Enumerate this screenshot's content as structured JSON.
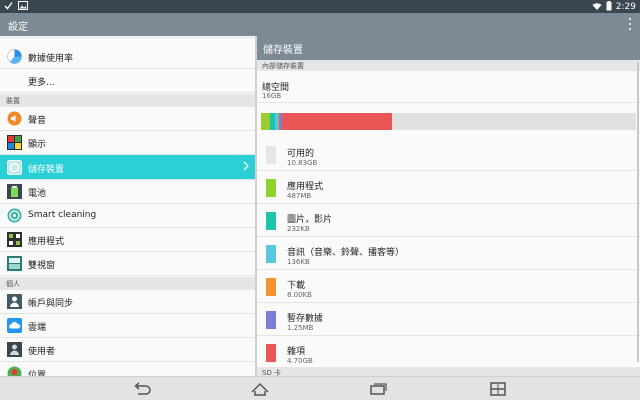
{
  "status_bar": {
    "time": "2:29"
  },
  "app_bar": {
    "title": "設定"
  },
  "left_list": {
    "partial_top": {
      "label": ""
    },
    "items_top": [
      {
        "label": "數據使用率",
        "icon": "data-usage-icon"
      },
      {
        "label": "更多..."
      }
    ],
    "section_device": "裝置",
    "device_items": [
      {
        "label": "聲音",
        "icon": "sound-icon"
      },
      {
        "label": "顯示",
        "icon": "display-icon"
      },
      {
        "label": "儲存裝置",
        "icon": "storage-icon"
      },
      {
        "label": "電池",
        "icon": "battery-icon"
      },
      {
        "label": "Smart cleaning",
        "icon": "smart-cleaning-icon"
      },
      {
        "label": "應用程式",
        "icon": "apps-icon"
      },
      {
        "label": "雙視窗",
        "icon": "dual-window-icon"
      }
    ],
    "section_personal": "個人",
    "personal_items": [
      {
        "label": "帳戶與同步",
        "icon": "accounts-sync-icon"
      },
      {
        "label": "雲端",
        "icon": "cloud-icon"
      },
      {
        "label": "使用者",
        "icon": "users-icon"
      },
      {
        "label": "位置",
        "icon": "location-icon"
      }
    ]
  },
  "right_pane": {
    "title": "儲存裝置",
    "section_internal": "內部儲存裝置",
    "total_label": "總空間",
    "total_value": "16GB",
    "usage_bar": {
      "segments": [
        {
          "name": "應用程式",
          "color": "#9acd32",
          "fraction": 0.025
        },
        {
          "name": "圖片，影片",
          "color": "#1ec4a7",
          "fraction": 0.012
        },
        {
          "name": "音訊（音樂、鈴聲、播客等）",
          "color": "#4fc9dc",
          "fraction": 0.008
        },
        {
          "name": "下載",
          "color": "#f5932f",
          "fraction": 0.004
        },
        {
          "name": "暫存數據",
          "color": "#7b7bd8",
          "fraction": 0.008
        },
        {
          "name": "雜項",
          "color": "#e85656",
          "fraction": 0.293
        },
        {
          "name": "可用的",
          "color": "#e0e0e0",
          "fraction": 0.65
        }
      ]
    },
    "items": [
      {
        "name": "可用的",
        "value": "10.83GB",
        "color": "#e6e6e6"
      },
      {
        "name": "應用程式",
        "value": "487MB",
        "color": "#8fd12f"
      },
      {
        "name": "圖片，影片",
        "value": "232KB",
        "color": "#1ec4a7"
      },
      {
        "name": "音訊（音樂、鈴聲、播客等）",
        "value": "136KB",
        "color": "#56c9dc"
      },
      {
        "name": "下載",
        "value": "8.00KB",
        "color": "#f5932f"
      },
      {
        "name": "暫存數據",
        "value": "1.25MB",
        "color": "#7b7bd8"
      },
      {
        "name": "雜項",
        "value": "4.70GB",
        "color": "#e85656"
      }
    ],
    "section_sd": "SD 卡"
  }
}
